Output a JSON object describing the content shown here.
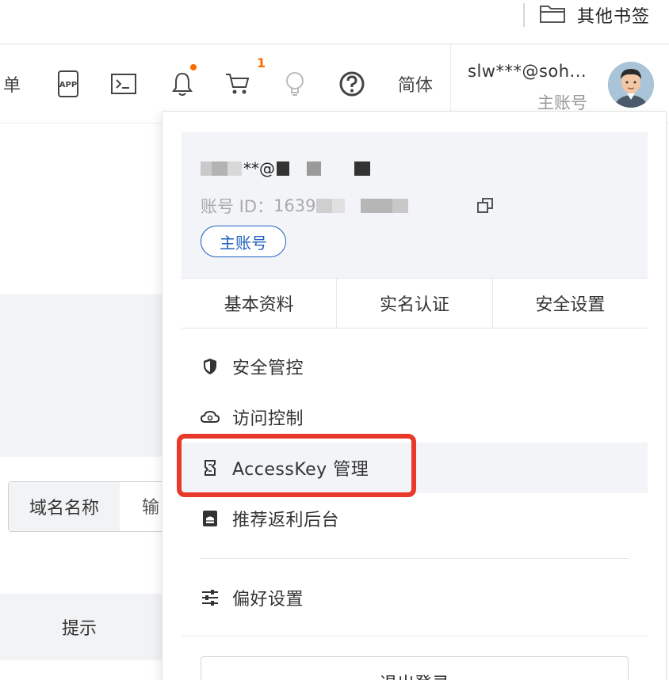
{
  "bookmarks": {
    "folder_label": "其他书签",
    "folder_icon": "folder-icon"
  },
  "topbar": {
    "cut_text": "单",
    "icons": [
      "app-icon",
      "terminal-icon",
      "bell-icon",
      "cart-icon",
      "lightbulb-icon",
      "help-icon"
    ],
    "cart_count": "1",
    "language": "简体",
    "user": {
      "name": "slw***@soh...",
      "role": "主账号"
    }
  },
  "page": {
    "search_select": "域名名称",
    "search_placeholder": "输",
    "table_header": "提示"
  },
  "profile": {
    "masked_email_fragment": "**@",
    "account_id_label": "账号 ID：",
    "account_id_partial": "1639",
    "main_account_tag": "主账号"
  },
  "tabs": [
    "基本资料",
    "实名认证",
    "安全设置"
  ],
  "menu": {
    "items": [
      {
        "label": "安全管控",
        "icon": "shield-icon"
      },
      {
        "label": "访问控制",
        "icon": "cloud-icon"
      },
      {
        "label": "AccessKey 管理",
        "icon": "key-icon"
      },
      {
        "label": "推荐返利后台",
        "icon": "rebate-icon"
      }
    ],
    "preference": {
      "label": "偏好设置",
      "icon": "sliders-icon"
    },
    "logout": "退出登录"
  },
  "colors": {
    "accent_blue": "#1f5fbf",
    "highlight_red": "#e8392a",
    "badge_orange": "#ff6a00",
    "panel_gray": "#f2f4f7"
  }
}
